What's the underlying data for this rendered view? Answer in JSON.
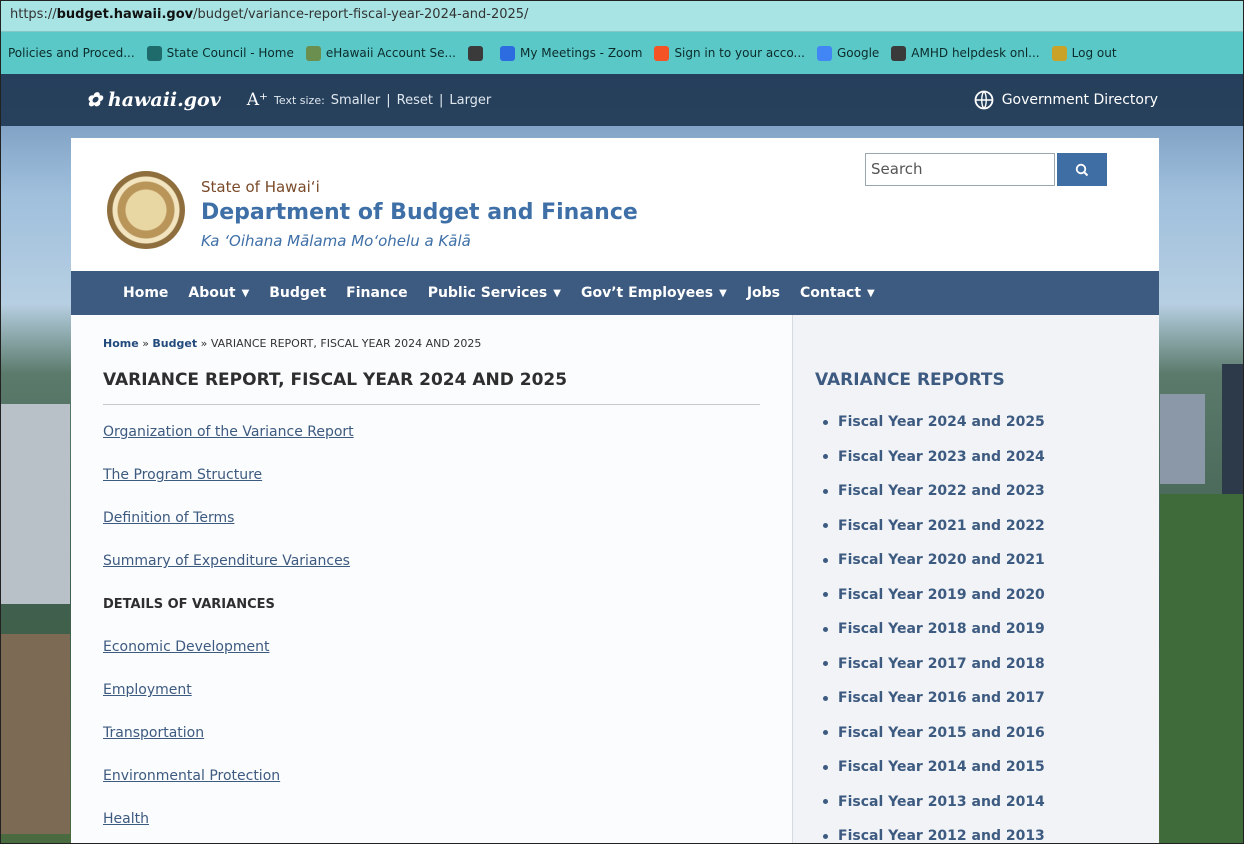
{
  "browser": {
    "url_prefix": "https://",
    "url_host": "budget.hawaii.gov",
    "url_path": "/budget/variance-report-fiscal-year-2024-and-2025/",
    "bookmarks": [
      {
        "label": "Policies and Proced...",
        "icon": "page-icon",
        "color": "#5bc8c8"
      },
      {
        "label": "State Council - Home",
        "icon": "sharepoint-icon",
        "color": "#1f6b6b"
      },
      {
        "label": "eHawaii Account Se...",
        "icon": "flower-icon",
        "color": "#6b8f4e"
      },
      {
        "label": "",
        "icon": "globe-icon",
        "color": "#3a3a3a"
      },
      {
        "label": "My Meetings - Zoom",
        "icon": "zoom-icon",
        "color": "#2d6be0"
      },
      {
        "label": "Sign in to your acco...",
        "icon": "microsoft-icon",
        "color": "#f35325"
      },
      {
        "label": "Google",
        "icon": "google-icon",
        "color": "#4285f4"
      },
      {
        "label": "AMHD helpdesk onl...",
        "icon": "globe-icon",
        "color": "#3a3a3a"
      },
      {
        "label": "Log out",
        "icon": "logout-icon",
        "color": "#c9a227"
      }
    ]
  },
  "gov_header": {
    "logo": "hawaii.gov",
    "text_size_label": "Text size:",
    "smaller": "Smaller",
    "reset": "Reset",
    "larger": "Larger",
    "sep": "|",
    "directory": "Government Directory"
  },
  "site": {
    "state": "State of Hawai‘i",
    "department": "Department of Budget and Finance",
    "hawaiian_name": "Ka ‘Oihana Mālama Mo‘ohelu a Kālā",
    "search_placeholder": "Search"
  },
  "nav": [
    {
      "label": "Home",
      "dropdown": false
    },
    {
      "label": "About",
      "dropdown": true
    },
    {
      "label": "Budget",
      "dropdown": false
    },
    {
      "label": "Finance",
      "dropdown": false
    },
    {
      "label": "Public Services",
      "dropdown": true
    },
    {
      "label": "Gov’t Employees",
      "dropdown": true
    },
    {
      "label": "Jobs",
      "dropdown": false
    },
    {
      "label": "Contact",
      "dropdown": true
    }
  ],
  "breadcrumb": {
    "home": "Home",
    "budget": "Budget",
    "sep": "»",
    "current": "VARIANCE REPORT, FISCAL YEAR 2024 AND 2025"
  },
  "page": {
    "title": "VARIANCE REPORT, FISCAL YEAR 2024 AND 2025",
    "items": [
      {
        "text": "Organization of the Variance Report",
        "link": true
      },
      {
        "text": "The Program Structure",
        "link": true
      },
      {
        "text": "Definition of Terms",
        "link": true
      },
      {
        "text": "Summary of Expenditure Variances",
        "link": true
      },
      {
        "text": "DETAILS OF VARIANCES",
        "link": false
      },
      {
        "text": "Economic Development",
        "link": true
      },
      {
        "text": "Employment",
        "link": true
      },
      {
        "text": "Transportation",
        "link": true
      },
      {
        "text": "Environmental Protection",
        "link": true
      },
      {
        "text": "Health",
        "link": true
      }
    ]
  },
  "sidebar": {
    "title": "VARIANCE REPORTS",
    "items": [
      "Fiscal Year 2024 and 2025",
      "Fiscal Year 2023 and 2024",
      "Fiscal Year 2022 and 2023",
      "Fiscal Year 2021 and 2022",
      "Fiscal Year 2020 and 2021",
      "Fiscal Year 2019 and 2020",
      "Fiscal Year 2018 and 2019",
      "Fiscal Year 2017 and 2018",
      "Fiscal Year 2016 and 2017",
      "Fiscal Year 2015 and 2016",
      "Fiscal Year 2014 and 2015",
      "Fiscal Year 2013 and 2014",
      "Fiscal Year 2012 and 2013"
    ]
  }
}
